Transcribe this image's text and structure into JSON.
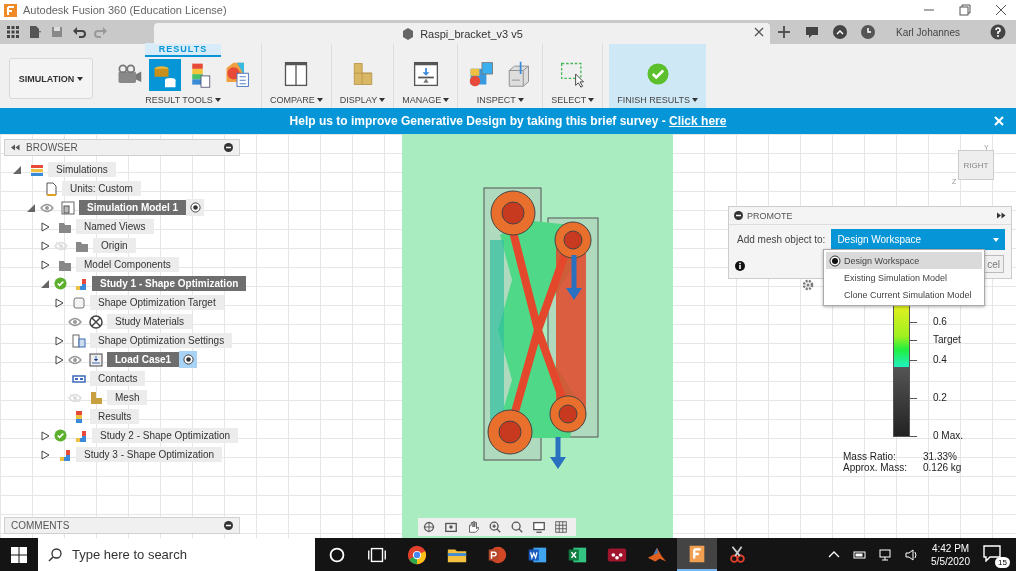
{
  "window": {
    "title": "Autodesk Fusion 360 (Education License)"
  },
  "quick_access": [
    {
      "kind": "grid"
    },
    {
      "kind": "file"
    },
    {
      "kind": "save"
    },
    {
      "kind": "undo"
    },
    {
      "kind": "redo"
    }
  ],
  "document_tab": {
    "title": "Raspi_bracket_v3 v5"
  },
  "user": {
    "name": "Karl Johannes"
  },
  "workspace": {
    "label": "SIMULATION"
  },
  "ribbon": {
    "tab": "RESULTS",
    "groups": [
      {
        "label": "RESULT TOOLS",
        "highlighted": false,
        "tools": [
          {
            "kind": "camera",
            "selected": false
          },
          {
            "kind": "promote",
            "selected": true
          },
          {
            "kind": "legend",
            "selected": false
          },
          {
            "kind": "contour",
            "selected": false
          }
        ]
      },
      {
        "label": "COMPARE",
        "highlighted": false,
        "tools": [
          {
            "kind": "compare",
            "selected": false
          }
        ]
      },
      {
        "label": "DISPLAY",
        "highlighted": false,
        "tools": [
          {
            "kind": "display",
            "selected": false
          }
        ]
      },
      {
        "label": "MANAGE",
        "highlighted": false,
        "tools": [
          {
            "kind": "manage",
            "selected": false
          }
        ]
      },
      {
        "label": "INSPECT",
        "highlighted": false,
        "tools": [
          {
            "kind": "inspect",
            "selected": false
          },
          {
            "kind": "probe",
            "selected": false
          }
        ]
      },
      {
        "label": "SELECT",
        "highlighted": false,
        "tools": [
          {
            "kind": "select",
            "selected": false
          }
        ]
      },
      {
        "label": "FINISH RESULTS",
        "highlighted": true,
        "tools": [
          {
            "kind": "finish",
            "selected": false
          }
        ]
      }
    ]
  },
  "banner": {
    "text": "Help us to improve Generative Design by taking this brief survey - ",
    "link": "Click here"
  },
  "browser": {
    "title": "BROWSER",
    "tree": [
      {
        "label": "Simulations",
        "kind": "simulations",
        "expanded": true,
        "highlighted": false,
        "children": [
          {
            "label": "Units: Custom",
            "kind": "units",
            "highlighted": false
          },
          {
            "label": "Simulation Model 1",
            "kind": "model",
            "expanded": true,
            "highlighted": true,
            "visible": true,
            "focused": false,
            "children": [
              {
                "label": "Named Views",
                "kind": "folder",
                "expanded": false,
                "highlighted": false
              },
              {
                "label": "Origin",
                "kind": "folder",
                "expanded": false,
                "highlighted": false,
                "visible": false
              },
              {
                "label": "Model Components",
                "kind": "folder",
                "expanded": false,
                "highlighted": false
              },
              {
                "label": "Study 1 - Shape Optimization",
                "kind": "study",
                "expanded": true,
                "highlighted": true,
                "completed": true,
                "children": [
                  {
                    "label": "Shape Optimization Target",
                    "kind": "target",
                    "expanded": false,
                    "highlighted": false
                  },
                  {
                    "label": "Study Materials",
                    "kind": "materials",
                    "highlighted": false,
                    "visible": true
                  },
                  {
                    "label": "Shape Optimization Settings",
                    "kind": "settings",
                    "expanded": false,
                    "highlighted": false
                  },
                  {
                    "label": "Load Case1",
                    "kind": "loadcase",
                    "expanded": false,
                    "highlighted": true,
                    "visible": true,
                    "focused": true
                  },
                  {
                    "label": "Contacts",
                    "kind": "contacts",
                    "highlighted": false
                  },
                  {
                    "label": "Mesh",
                    "kind": "mesh",
                    "highlighted": false,
                    "visible": false
                  },
                  {
                    "label": "Results",
                    "kind": "results",
                    "highlighted": false
                  }
                ]
              },
              {
                "label": "Study 2 - Shape Optimization",
                "kind": "study",
                "expanded": false,
                "highlighted": false,
                "completed": true
              },
              {
                "label": "Study 3 - Shape Optimization",
                "kind": "study",
                "expanded": false,
                "highlighted": false
              }
            ]
          }
        ]
      }
    ]
  },
  "comments": {
    "title": "COMMENTS"
  },
  "viewcube": {
    "face": "RIGHT",
    "axis_z": "Z",
    "axis_y": "Y"
  },
  "promote": {
    "title": "PROMOTE",
    "field_label": "Add mesh object to:",
    "value": "Design Workspace",
    "cancel_text": "cel",
    "options": [
      {
        "label": "Design Workspace",
        "selected": true
      },
      {
        "label": "Existing Simulation Model",
        "selected": false
      },
      {
        "label": "Clone Current Simulation Model",
        "selected": false
      }
    ]
  },
  "legend": {
    "labels": [
      "0.6",
      "Target",
      "0.4",
      "0.2",
      "0 Max."
    ]
  },
  "mass": [
    {
      "label": "Mass Ratio:",
      "value": "31.33%"
    },
    {
      "label": "Approx. Mass:",
      "value": "0.126 kg"
    }
  ],
  "nav_bar": [
    {
      "kind": "orbit"
    },
    {
      "kind": "look"
    },
    {
      "kind": "pan"
    },
    {
      "kind": "zoom"
    },
    {
      "kind": "fit"
    },
    {
      "kind": "display"
    },
    {
      "kind": "grid"
    }
  ],
  "taskbar": {
    "search_placeholder": "Type here to search",
    "apps": [
      {
        "kind": "cortana",
        "active": false
      },
      {
        "kind": "taskview",
        "active": false
      },
      {
        "kind": "chrome",
        "active": false
      },
      {
        "kind": "explorer",
        "active": false
      },
      {
        "kind": "powerpoint",
        "active": false
      },
      {
        "kind": "word",
        "active": false
      },
      {
        "kind": "excel",
        "active": false
      },
      {
        "kind": "mendeley",
        "active": false
      },
      {
        "kind": "matlab",
        "active": false
      },
      {
        "kind": "fusion",
        "active": true
      },
      {
        "kind": "snip",
        "active": false
      }
    ],
    "time": "4:42 PM",
    "date": "5/5/2020",
    "notifications": "15"
  }
}
